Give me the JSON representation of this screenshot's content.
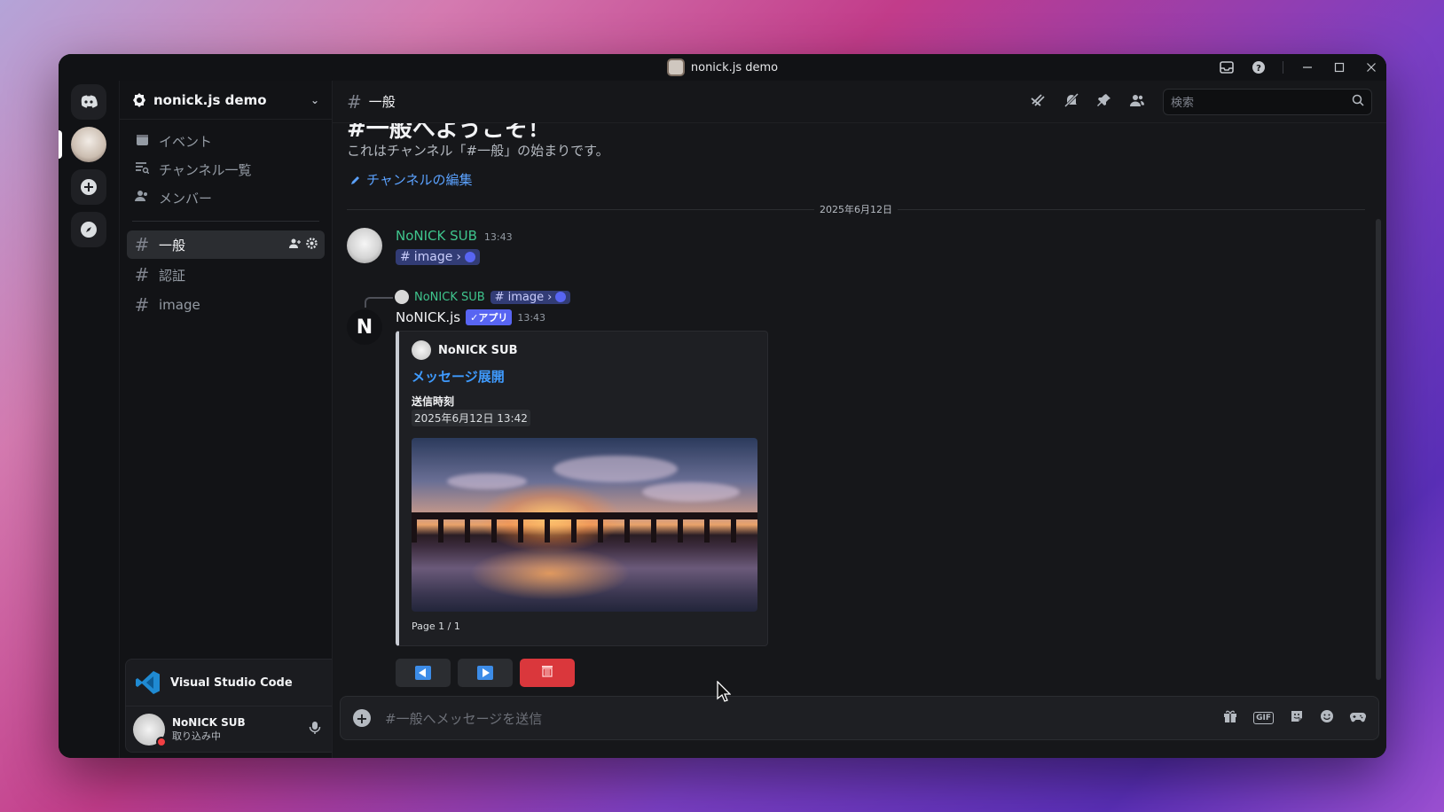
{
  "window": {
    "title": "nonick.js demo"
  },
  "titlebar_icons": [
    "inbox-icon",
    "help-icon",
    "minimize-icon",
    "maximize-icon",
    "close-icon"
  ],
  "sidebar": {
    "guild_name": "nonick.js demo",
    "nav": [
      {
        "label": "イベント",
        "icon": "calendar-icon"
      },
      {
        "label": "チャンネル一覧",
        "icon": "channel-list-icon"
      },
      {
        "label": "メンバー",
        "icon": "members-icon"
      }
    ],
    "channels": [
      {
        "name": "一般",
        "active": true
      },
      {
        "name": "認証",
        "active": false
      },
      {
        "name": "image",
        "active": false
      }
    ]
  },
  "activity": {
    "app_name": "Visual Studio Code"
  },
  "user": {
    "name": "NoNICK SUB",
    "status": "取り込み中"
  },
  "header": {
    "channel_name": "一般",
    "search_placeholder": "検索"
  },
  "welcome": {
    "title": "#一般へようこそ！",
    "subtitle": "これはチャンネル「#一般」の始まりです。",
    "edit_link": "チャンネルの編集"
  },
  "date_separator": "2025年6月12日",
  "messages": [
    {
      "author": "NoNICK SUB",
      "time": "13:43",
      "mention_channel": "image"
    },
    {
      "reply": {
        "author": "NoNICK SUB",
        "channel": "image"
      },
      "author": "NoNICK.js",
      "badge": "✓アプリ",
      "time": "13:43",
      "embed": {
        "author": "NoNICK SUB",
        "title": "メッセージ展開",
        "field_name": "送信時刻",
        "field_value": "2025年6月12日 13:42",
        "footer": "Page 1 / 1"
      }
    }
  ],
  "composer": {
    "placeholder": "#一般へメッセージを送信"
  },
  "colors": {
    "accent": "#5865f2",
    "link": "#3f9bff",
    "username_green": "#3fc58d",
    "danger": "#da373c"
  }
}
